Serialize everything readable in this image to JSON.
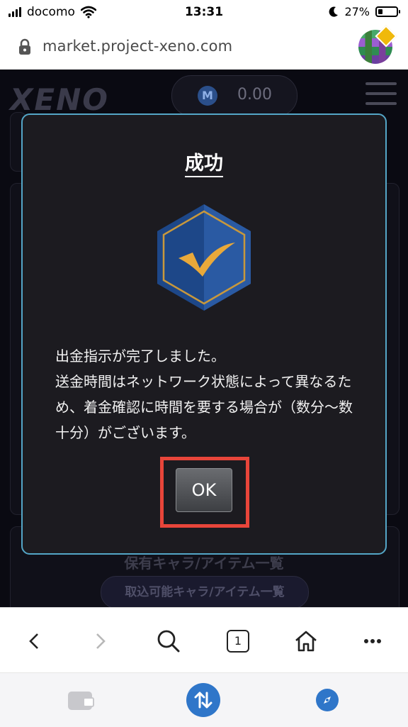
{
  "status_bar": {
    "carrier": "docomo",
    "time": "13:31",
    "battery": "27%"
  },
  "browser": {
    "url": "market.project-xeno.com",
    "tab_count": "1"
  },
  "background_page": {
    "logo": "XENO",
    "point_value": "0.00",
    "point_icon_letter": "M",
    "list_title": "保有キャラ/アイテム一覧",
    "import_button": "取込可能キャラ/アイテム一覧"
  },
  "modal": {
    "title": "成功",
    "message": "出金指示が完了しました。\n送金時間はネットワーク状態によって異なるため、着金確認に時間を要する場合が（数分〜数十分）がございます。",
    "ok_label": "OK"
  },
  "colors": {
    "modal_border": "#54a6c7",
    "highlight": "#e8453a",
    "badge_blue": "#1e4a8f",
    "check_gold": "#e9a93a"
  },
  "icons": [
    "signal-icon",
    "wifi-icon",
    "moon-icon",
    "battery-icon",
    "lock-icon",
    "wallet-avatar-icon",
    "success-badge-icon",
    "back-icon",
    "forward-icon",
    "search-icon",
    "home-icon",
    "more-icon",
    "wallet-icon",
    "swap-icon",
    "discover-icon"
  ]
}
